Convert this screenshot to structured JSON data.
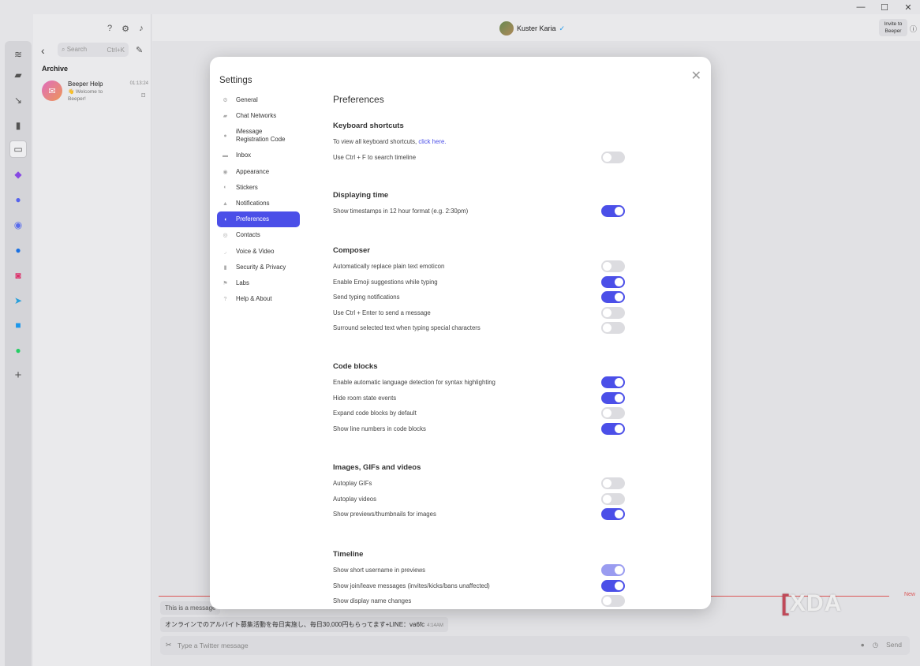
{
  "window": {
    "minimize": "—",
    "maximize": "☐",
    "close": "✕"
  },
  "rail": {
    "icons": [
      "layers-icon",
      "chat-bubble-icon",
      "low-priority-icon",
      "bookmark-icon",
      "inbox-icon",
      "beeper-icon",
      "discord-icon",
      "messenger-icon",
      "google-messages-icon",
      "instagram-icon",
      "telegram-icon",
      "twitter-icon",
      "whatsapp-icon",
      "add-icon"
    ]
  },
  "chatlist": {
    "search_placeholder": "Search",
    "search_shortcut": "Ctrl+K",
    "archive_label": "Archive",
    "items": [
      {
        "name": "Beeper Help",
        "time": "01:13:24",
        "preview": "👋 Welcome to Beeper!"
      }
    ]
  },
  "header": {
    "contact_name": "Kuster Karia",
    "invite_label": "Invite to Beeper"
  },
  "messages": {
    "new_label": "New",
    "msg1": "This is a message",
    "msg2_text": "オンラインでのアルバイト募集活動を毎日実施し、毎日30,000円もらってます+LINE：va6fc",
    "msg2_time": "4:14AM"
  },
  "composer": {
    "placeholder": "Type a Twitter message",
    "send_label": "Send"
  },
  "watermark": "XDA",
  "settings": {
    "title": "Settings",
    "nav": [
      {
        "label": "General",
        "icon": "gear-icon"
      },
      {
        "label": "Chat Networks",
        "icon": "chat-networks-icon"
      },
      {
        "label": "iMessage Registration Code",
        "icon": "apple-icon"
      },
      {
        "label": "Inbox",
        "icon": "inbox-icon"
      },
      {
        "label": "Appearance",
        "icon": "eye-icon"
      },
      {
        "label": "Stickers",
        "icon": "sticker-icon"
      },
      {
        "label": "Notifications",
        "icon": "bell-icon"
      },
      {
        "label": "Preferences",
        "icon": "toggle-icon"
      },
      {
        "label": "Contacts",
        "icon": "contacts-icon"
      },
      {
        "label": "Voice & Video",
        "icon": "phone-icon"
      },
      {
        "label": "Security & Privacy",
        "icon": "lock-icon"
      },
      {
        "label": "Labs",
        "icon": "flag-icon"
      },
      {
        "label": "Help & About",
        "icon": "help-icon"
      }
    ],
    "active": "Preferences",
    "page_title": "Preferences",
    "sections": [
      {
        "title": "Keyboard shortcuts",
        "note": "To view all keyboard shortcuts, ",
        "note_link": "click here.",
        "rows": [
          {
            "label": "Use Ctrl + F to search timeline",
            "state": "off"
          }
        ]
      },
      {
        "title": "Displaying time",
        "rows": [
          {
            "label": "Show timestamps in 12 hour format (e.g. 2:30pm)",
            "state": "on"
          }
        ]
      },
      {
        "title": "Composer",
        "rows": [
          {
            "label": "Automatically replace plain text emoticon",
            "state": "off"
          },
          {
            "label": "Enable Emoji suggestions while typing",
            "state": "on"
          },
          {
            "label": "Send typing notifications",
            "state": "on"
          },
          {
            "label": "Use Ctrl + Enter to send a message",
            "state": "off"
          },
          {
            "label": "Surround selected text when typing special characters",
            "state": "off"
          }
        ]
      },
      {
        "title": "Code blocks",
        "rows": [
          {
            "label": "Enable automatic language detection for syntax highlighting",
            "state": "on"
          },
          {
            "label": "Hide room state events",
            "state": "on"
          },
          {
            "label": "Expand code blocks by default",
            "state": "off"
          },
          {
            "label": "Show line numbers in code blocks",
            "state": "on"
          }
        ]
      },
      {
        "title": "Images, GIFs and videos",
        "rows": [
          {
            "label": "Autoplay GIFs",
            "state": "off"
          },
          {
            "label": "Autoplay videos",
            "state": "off"
          },
          {
            "label": "Show previews/thumbnails for images",
            "state": "on"
          }
        ]
      },
      {
        "title": "Timeline",
        "rows": [
          {
            "label": "Show short username in previews",
            "state": "half"
          },
          {
            "label": "Show join/leave messages (invites/kicks/bans unaffected)",
            "state": "on"
          },
          {
            "label": "Show display name changes",
            "state": "off"
          }
        ]
      }
    ]
  },
  "colors": {
    "accent": "#4b4fe8",
    "toggle_off": "#dcdce0",
    "new_line": "#e05a5a"
  }
}
